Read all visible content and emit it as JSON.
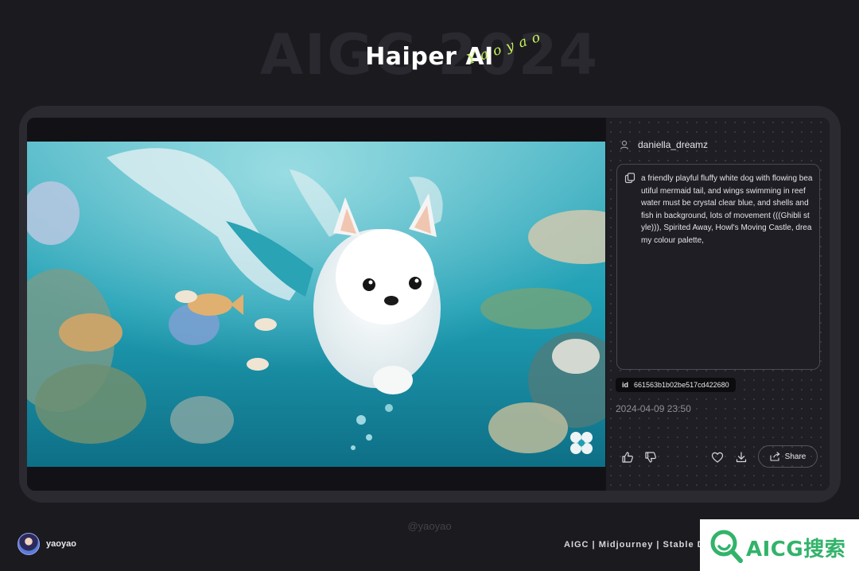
{
  "header": {
    "background_text": "AIGC 2024",
    "title": "Haiper AI",
    "signature": "Yaoyao"
  },
  "post": {
    "username": "daniella_dreamz",
    "prompt": "a friendly playful fluffy white dog with flowing beautiful mermaid tail, and wings swimming in reef water must be crystal clear blue, and shells and fish in background, lots of movement (((Ghibli style))), Spirited Away, Howl's Moving Castle, dreamy colour palette,",
    "id_label": "id",
    "id_value": "661563b1b02be517cd422680",
    "timestamp": "2024-04-09 23:50",
    "share_label": "Share"
  },
  "footer": {
    "watermark": "@yaoyao",
    "author": "yaoyao",
    "tags": "AIGC | Midjourney | Stable Diffusion",
    "brand": "AICG搜索"
  },
  "icons": {
    "user": "user-icon",
    "copy": "copy-icon",
    "like": "thumbs-up-icon",
    "dislike": "thumbs-down-icon",
    "favorite": "heart-icon",
    "download": "download-icon",
    "share": "share-icon",
    "logo": "haiper-logo-icon",
    "brand": "magnifier-logo-icon"
  },
  "colors": {
    "background": "#1b1a1f",
    "accent_signature": "#c6f25d",
    "brand_green": "#32b36a"
  }
}
